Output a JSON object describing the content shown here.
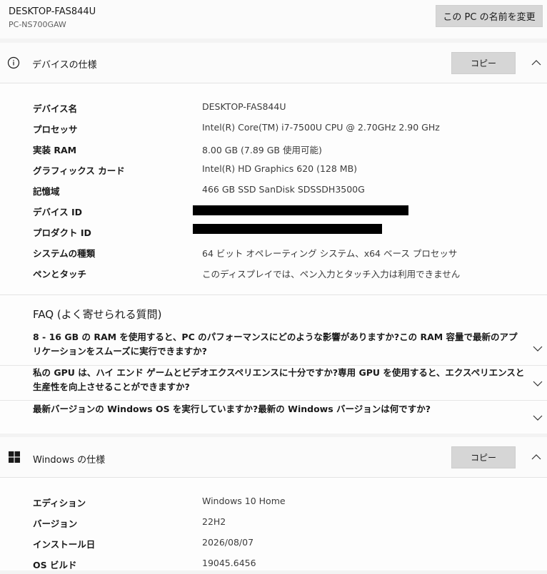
{
  "device_header": {
    "name": "DESKTOP-FAS844U",
    "model": "PC-NS700GAW",
    "rename_button": "この PC の名前を変更"
  },
  "device_specs": {
    "title": "デバイスの仕様",
    "copy_label": "コピー",
    "rows": [
      {
        "label": "デバイス名",
        "value": "DESKTOP-FAS844U"
      },
      {
        "label": "プロセッサ",
        "value": "Intel(R) Core(TM) i7-7500U CPU @ 2.70GHz   2.90 GHz"
      },
      {
        "label": "実装 RAM",
        "value": "8.00 GB (7.89 GB 使用可能)"
      },
      {
        "label": "グラフィックス カード",
        "value": "Intel(R) HD Graphics 620 (128 MB)"
      },
      {
        "label": "記憶域",
        "value": "466 GB SSD SanDisk SDSSDH3500G"
      },
      {
        "label": "デバイス ID",
        "value": ""
      },
      {
        "label": "プロダクト ID",
        "value": ""
      },
      {
        "label": "システムの種類",
        "value": "64 ビット オペレーティング システム、x64 ベース プロセッサ"
      },
      {
        "label": "ペンとタッチ",
        "value": "このディスプレイでは、ペン入力とタッチ入力は利用できません"
      }
    ]
  },
  "faq": {
    "title": "FAQ (よく寄せられる質問)",
    "items": [
      {
        "line1": "8 - 16 GB の RAM を使用すると、PC のパフォーマンスにどのような影響がありますか?この RAM 容量で最新のアプ",
        "line2": "リケーションをスムーズに実行できますか?"
      },
      {
        "line1": "私の GPU は、ハイ エンド ゲームとビデオエクスペリエンスに十分ですか?専用 GPU を使用すると、エクスペリエンスと",
        "line2": "生産性を向上させることができますか?"
      },
      {
        "line1": "最新バージョンの Windows OS を実行していますか?最新の Windows バージョンは何ですか?",
        "line2": ""
      }
    ]
  },
  "windows_specs": {
    "title": "Windows の仕様",
    "copy_label": "コピー",
    "rows": [
      {
        "label": "エディション",
        "value": "Windows 10 Home"
      },
      {
        "label": "バージョン",
        "value": "22H2"
      },
      {
        "label": "インストール日",
        "value": "2026/08/07"
      },
      {
        "label": "OS ビルド",
        "value": "19045.6456"
      }
    ]
  },
  "colors": {
    "background": "#f3f3f3",
    "card": "#fbfbfb",
    "button": "#d6d6d6",
    "redaction": "#000000"
  },
  "icons": {
    "device_section": "info-icon",
    "windows_section": "windows-logo-icon",
    "collapse": "chevron-up-icon",
    "expand": "chevron-down-icon"
  }
}
